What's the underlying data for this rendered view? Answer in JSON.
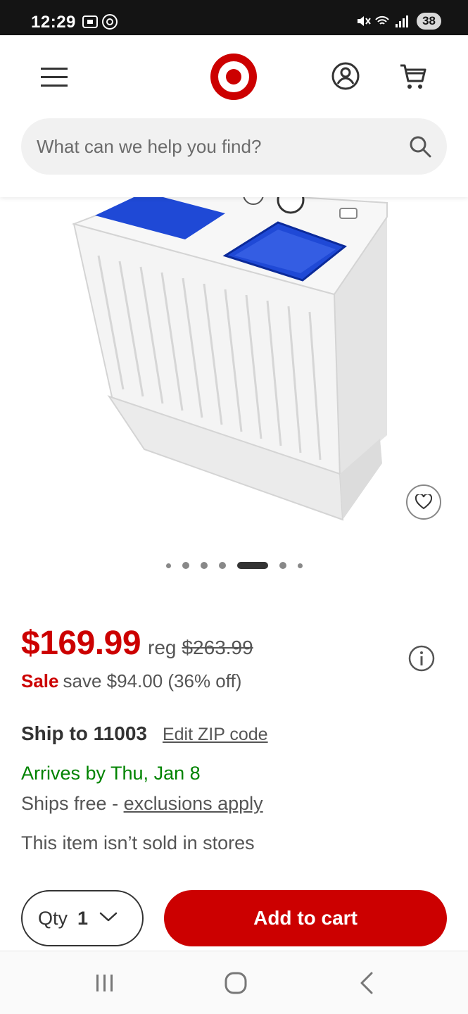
{
  "status_bar": {
    "time": "12:29",
    "battery": "38"
  },
  "header": {
    "search_placeholder": "What can we help you find?"
  },
  "product": {
    "image_count": 7,
    "active_image_index": 4
  },
  "pricing": {
    "price": "$169.99",
    "reg_label": "reg",
    "reg_price": "$263.99",
    "sale_label": "Sale",
    "save_text": "save $94.00 (36% off)"
  },
  "shipping": {
    "ship_to": "Ship to 11003",
    "edit_zip": "Edit ZIP code",
    "arrives": "Arrives by Thu, Jan 8",
    "ships_free_prefix": "Ships free - ",
    "exclusions_link": "exclusions apply",
    "not_sold": "This item isn’t sold in stores"
  },
  "actions": {
    "qty_label": "Qty",
    "qty_value": "1",
    "add_to_cart": "Add to cart"
  },
  "colors": {
    "brand_red": "#cc0000",
    "arrival_green": "#008300",
    "washer_blue": "#1f49d6"
  },
  "icons": [
    "menu-icon",
    "target-logo",
    "account-icon",
    "cart-icon",
    "search-icon",
    "heart-icon",
    "info-icon",
    "chevron-down-icon",
    "recent-apps-icon",
    "home-icon",
    "back-icon"
  ]
}
